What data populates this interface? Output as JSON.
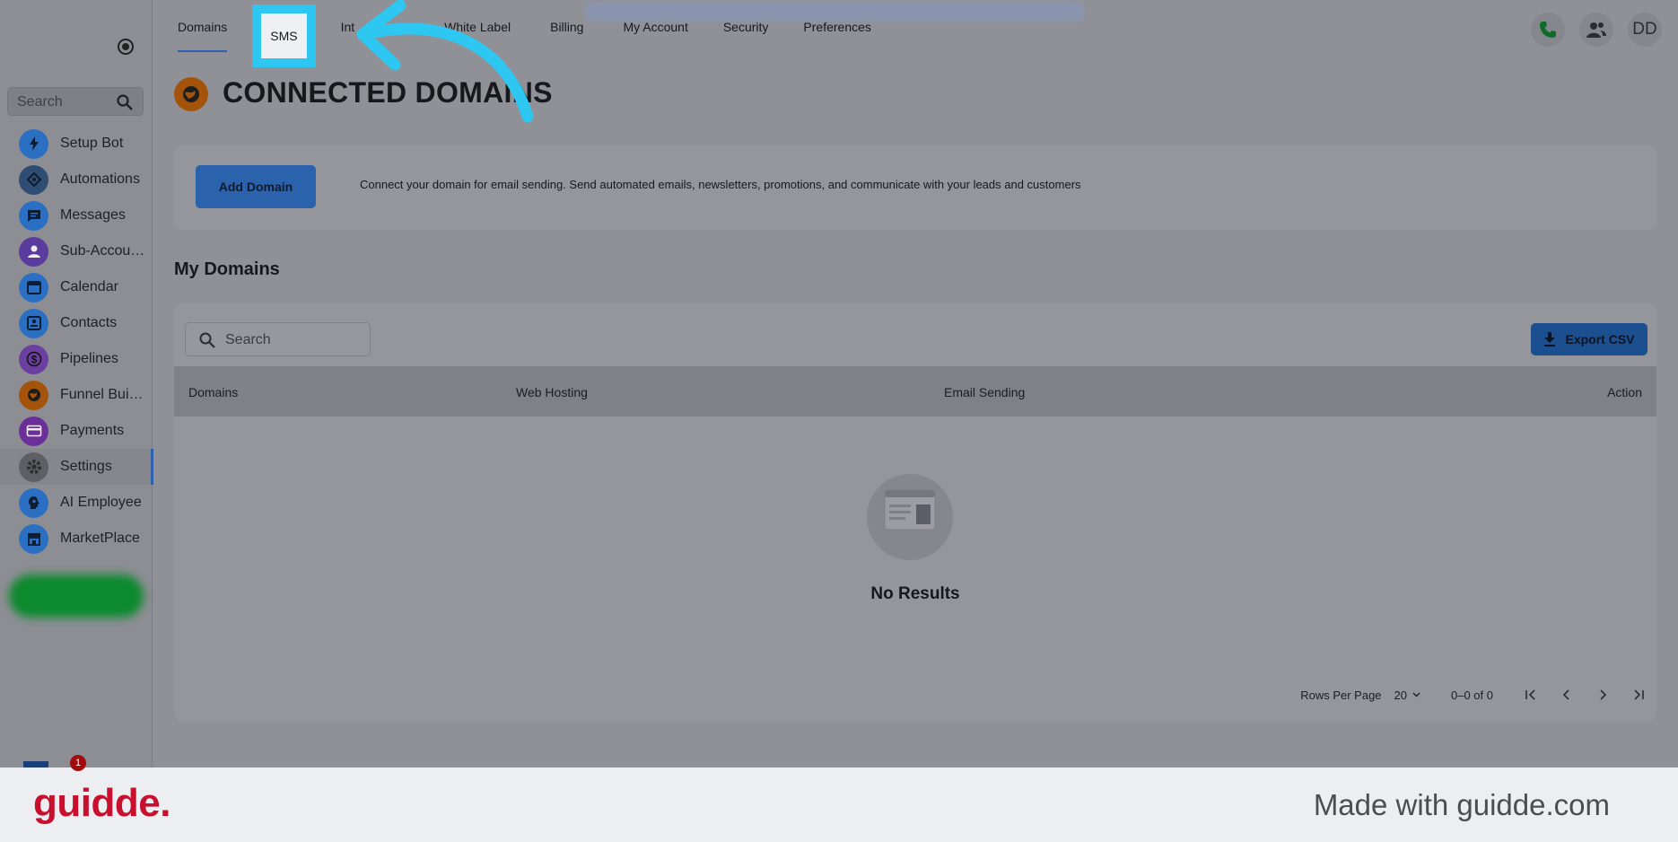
{
  "sidebar": {
    "search_placeholder": "Search",
    "items": [
      {
        "label": "Setup Bot",
        "icon": "bolt-icon",
        "color": "#2b6fc2"
      },
      {
        "label": "Automations",
        "icon": "automation-icon",
        "color": "#2f4d73"
      },
      {
        "label": "Messages",
        "icon": "chat-icon",
        "color": "#2b6fc2"
      },
      {
        "label": "Sub-Accounts",
        "icon": "user-icon",
        "color": "#5b3c9e"
      },
      {
        "label": "Calendar",
        "icon": "calendar-icon",
        "color": "#2b6fc2"
      },
      {
        "label": "Contacts",
        "icon": "contact-card-icon",
        "color": "#2b6fc2"
      },
      {
        "label": "Pipelines",
        "icon": "dollar-icon",
        "color": "#6b3fa0"
      },
      {
        "label": "Funnel Builder",
        "icon": "globe-icon",
        "color": "#a4540a"
      },
      {
        "label": "Payments",
        "icon": "credit-card-icon",
        "color": "#6b2f9a"
      },
      {
        "label": "Settings",
        "icon": "gear-icon",
        "color": "#5d5f64"
      },
      {
        "label": "AI Employee",
        "icon": "ai-head-icon",
        "color": "#2b6fc2"
      },
      {
        "label": "MarketPlace",
        "icon": "store-icon",
        "color": "#2b6fc2"
      }
    ],
    "notification_count": "1"
  },
  "tabs": [
    {
      "label": "Domains"
    },
    {
      "label": "SMS"
    },
    {
      "label": "Int"
    },
    {
      "label": "White Label"
    },
    {
      "label": "Billing"
    },
    {
      "label": "My Account"
    },
    {
      "label": "Security"
    },
    {
      "label": "Preferences"
    }
  ],
  "header": {
    "avatar_initials": "DD",
    "icons": [
      "phone-icon",
      "team-icon"
    ]
  },
  "page": {
    "title": "CONNECTED DOMAINS",
    "add_button": "Add Domain",
    "add_description": "Connect your domain for email sending. Send automated emails, newsletters, promotions, and communicate with your leads and customers",
    "section_title": "My Domains"
  },
  "table": {
    "search_placeholder": "Search",
    "export_label": "Export CSV",
    "columns": [
      "Domains",
      "Web Hosting",
      "Email Sending",
      "Action"
    ],
    "empty_text": "No Results",
    "rows_per_page_label": "Rows Per Page",
    "rows_per_page": "20",
    "range": "0–0 of 0"
  },
  "footer": {
    "brand": "guidde.",
    "made_with": "Made with guidde.com"
  },
  "colors": {
    "highlight": "#2ec7f2",
    "brand_red": "#c8102e",
    "accent_blue": "#2f5fb0"
  }
}
